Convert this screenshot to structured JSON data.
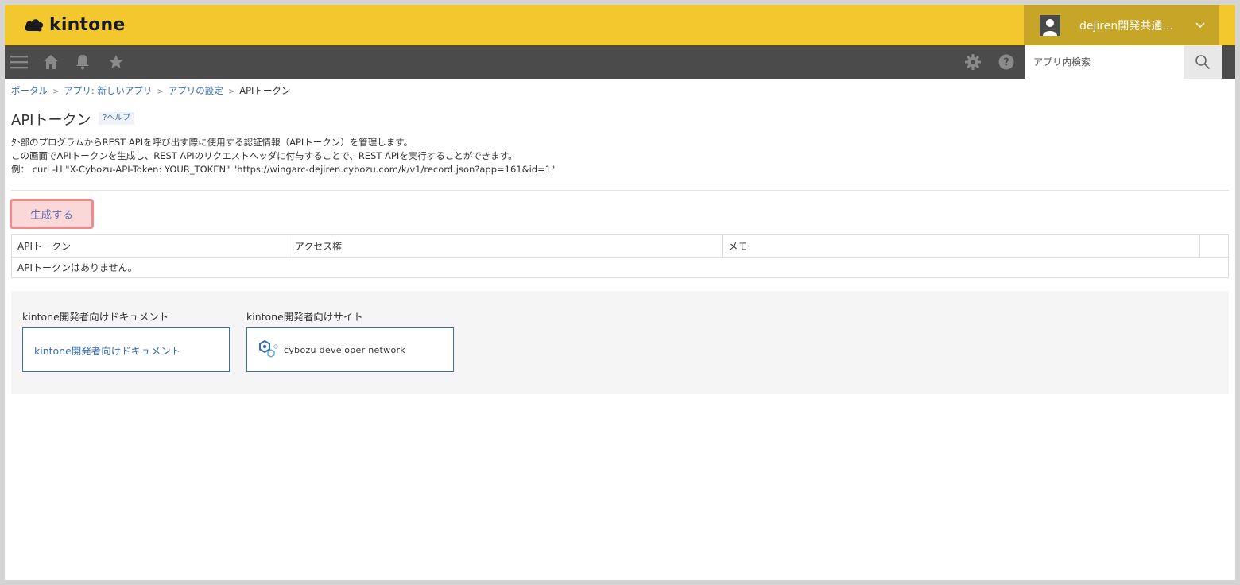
{
  "header": {
    "logo_text": "kintone",
    "user_name": "dejiren開発共通…"
  },
  "navbar": {
    "icons": [
      "menu-icon",
      "home-icon",
      "bell-icon",
      "star-icon",
      "gear-icon",
      "help-icon",
      "search-icon"
    ],
    "search_placeholder": "アプリ内検索"
  },
  "breadcrumb": {
    "portal": "ポータル",
    "app": "アプリ: 新しいアプリ",
    "settings": "アプリの設定",
    "current": "APIトークン",
    "separator": ">"
  },
  "page": {
    "title": "APIトークン",
    "help_label": "?ヘルプ",
    "description": [
      "外部のプログラムからREST APIを呼び出す際に使用する認証情報（APIトークン）を管理します。",
      "この画面でAPIトークンを生成し、REST APIのリクエストヘッダに付与することで、REST APIを実行することができます。",
      "例： curl -H \"X-Cybozu-API-Token: YOUR_TOKEN\" \"https://wingarc-dejiren.cybozu.com/k/v1/record.json?app=161&id=1\""
    ],
    "generate_button": "生成する"
  },
  "token_table": {
    "columns": [
      "APIトークン",
      "アクセス権",
      "メモ",
      ""
    ],
    "empty_message": "APIトークンはありません。"
  },
  "dev_links": {
    "docs_title": "kintone開発者向けドキュメント",
    "docs_link": "kintone開発者向けドキュメント",
    "site_title": "kintone開発者向けサイト",
    "site_link": "cybozu developer network"
  },
  "colors": {
    "header_bg": "#f2c82e",
    "navbar_bg": "#4b4b4b",
    "link": "#3a6fb0",
    "highlight_border": "#f08a8a"
  }
}
